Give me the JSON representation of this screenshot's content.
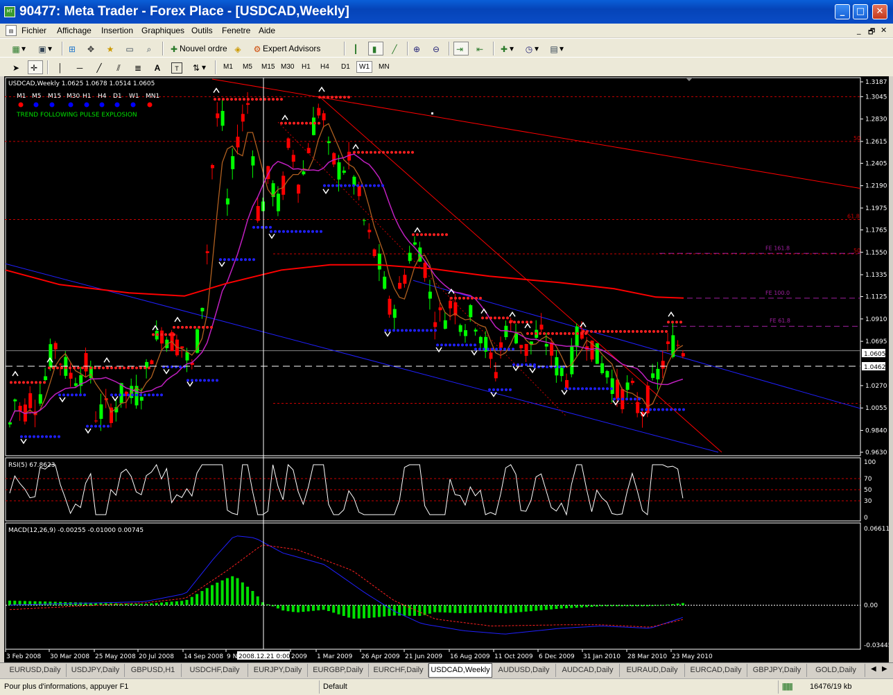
{
  "window": {
    "title": "90477: Meta Trader - Forex Place - [USDCAD,Weekly]",
    "minimize": "_",
    "maximize": "□",
    "close": "✕"
  },
  "menu": {
    "items": [
      "Fichier",
      "Affichage",
      "Insertion",
      "Graphiques",
      "Outils",
      "Fenetre",
      "Aide"
    ],
    "mdi_controls": [
      "_",
      "🗗",
      "✕"
    ]
  },
  "toolbar": {
    "new_order_label": "Nouvel ordre",
    "expert_advisors_label": "Expert Advisors",
    "timeframes": [
      "M1",
      "M5",
      "M15",
      "M30",
      "H1",
      "H4",
      "D1",
      "W1",
      "MN"
    ],
    "active_timeframe": "W1"
  },
  "chart": {
    "info": "USDCAD,Weekly  1.0625 1.0678 1.0514 1.0605",
    "tf_labels": [
      "M1",
      "M5",
      "M15",
      "M30",
      "H1",
      "H4",
      "D1",
      "W1",
      "MN1"
    ],
    "tf_dot_colors": [
      "#ff0000",
      "#0000ff",
      "#0000ff",
      "#0000ff",
      "#0000ff",
      "#0000ff",
      "#0000ff",
      "#0000ff",
      "#ff0000"
    ],
    "indicator_text": "TREND FOLLOWING  PULSE  EXPLOSION",
    "price_scale": [
      "1.3187",
      "1.3045",
      "1.2830",
      "1.2615",
      "1.2405",
      "1.2190",
      "1.1975",
      "1.1765",
      "1.1550",
      "1.1335",
      "1.1125",
      "1.0910",
      "1.0695",
      "1.0605",
      "1.0462",
      "1.0270",
      "1.0055",
      "0.9840",
      "0.9630"
    ],
    "current_price": "1.0605",
    "crosshair_price": "1.0462",
    "fib_labels": [
      "50",
      "61.8",
      "50",
      "FE 161.8",
      "FE 100.0",
      "FE 61.8"
    ],
    "rsi_label": "RSI(5) 67.8623",
    "rsi_scale": [
      "100",
      "70",
      "50",
      "30",
      "0"
    ],
    "macd_label": "MACD(12,26,9) -0.00255 -0.01000 0.00745",
    "macd_scale": [
      "0.06611",
      "0.00",
      "-0.03445"
    ],
    "time_axis": [
      "3 Feb 2008",
      "30 Mar 2008",
      "25 May 2008",
      "20 Jul 2008",
      "14 Sep 2008",
      "9 N",
      "2009",
      "1 Mar 2009",
      "26 Apr 2009",
      "21 Jun 2009",
      "16 Aug 2009",
      "11 Oct 2009",
      "6 Dec 2009",
      "31 Jan 2010",
      "28 Mar 2010",
      "23 May 2010"
    ],
    "crosshair_time": "2008.12.21 0:00",
    "colors": {
      "bull": "#00ff00",
      "bear": "#ff0000",
      "ma_red": "#ff0000",
      "ma_purple": "#c020c0",
      "ma_brown": "#b06020",
      "channel": "#0000ff",
      "background": "#000000"
    }
  },
  "tabs": {
    "items": [
      "EURUSD,Daily",
      "USDJPY,Daily",
      "GBPUSD,H1",
      "USDCHF,Daily",
      "EURJPY,Daily",
      "EURGBP,Daily",
      "EURCHF,Daily",
      "USDCAD,Weekly",
      "AUDUSD,Daily",
      "AUDCAD,Daily",
      "EURAUD,Daily",
      "EURCAD,Daily",
      "GBPJPY,Daily",
      "GOLD,Daily"
    ],
    "active": "USDCAD,Weekly"
  },
  "status": {
    "help": "Pour plus d'informations, appuyer F1",
    "profile": "Default",
    "traffic": "16476/19 kb"
  }
}
